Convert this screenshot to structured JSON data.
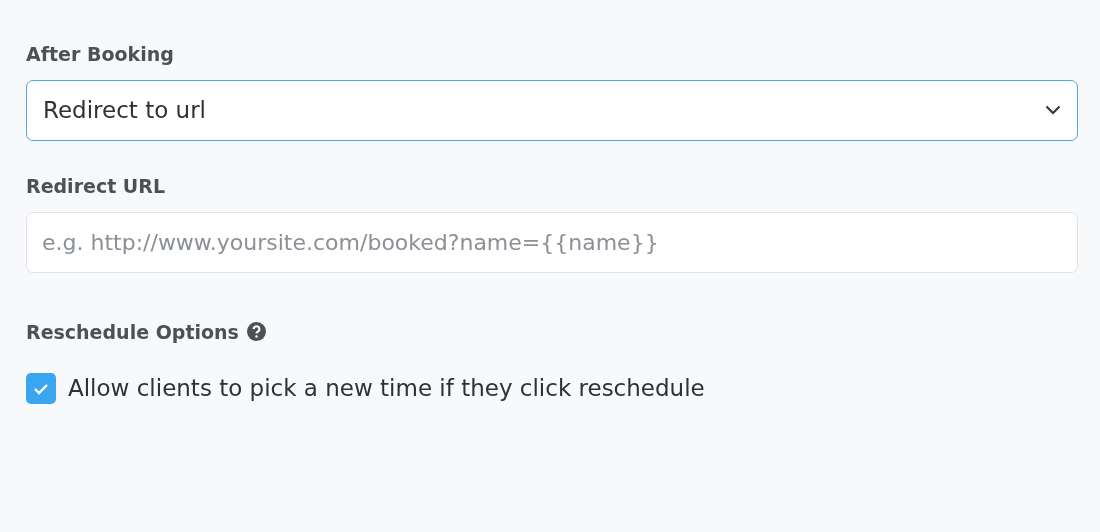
{
  "after_booking": {
    "label": "After Booking",
    "value": "Redirect to url"
  },
  "redirect_url": {
    "label": "Redirect URL",
    "placeholder": "e.g. http://www.yoursite.com/booked?name={{name}}"
  },
  "reschedule": {
    "label": "Reschedule Options",
    "option": {
      "label": "Allow clients to pick a new time if they click reschedule",
      "checked": true
    }
  }
}
